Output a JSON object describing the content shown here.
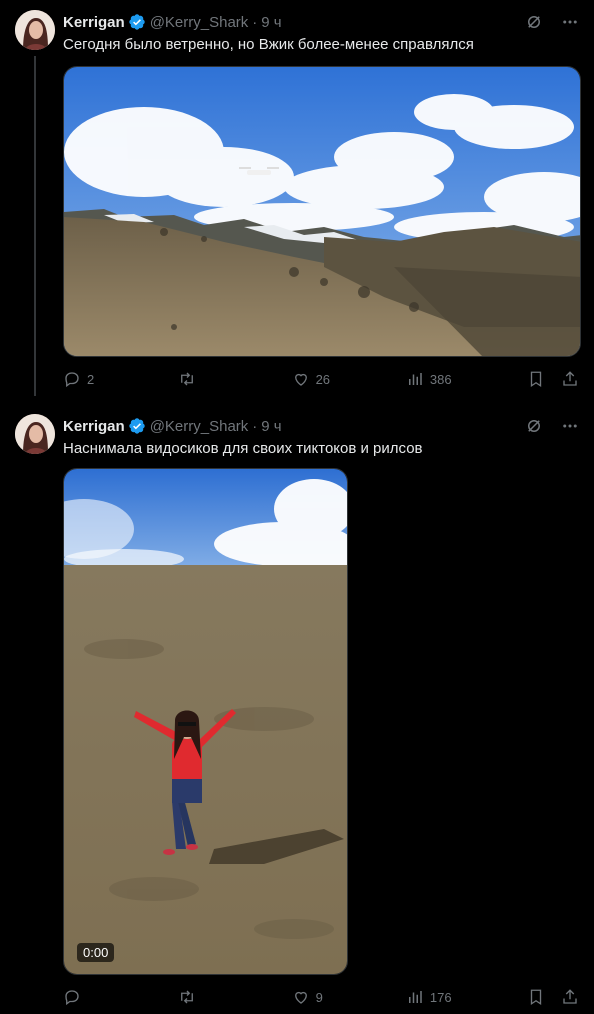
{
  "tweets": [
    {
      "author_name": "Kerrigan",
      "handle": "@Kerry_Shark",
      "separator": "·",
      "time": "9 ч",
      "text": "Сегодня было ветренно, но Вжик более-менее справлялся",
      "replies": "2",
      "retweets": "",
      "likes": "26",
      "views": "386"
    },
    {
      "author_name": "Kerrigan",
      "handle": "@Kerry_Shark",
      "separator": "·",
      "time": "9 ч",
      "text": "Наснимала видосиков для своих тиктоков и рилсов",
      "video_time": "0:00",
      "replies": "",
      "retweets": "",
      "likes": "9",
      "views": "176"
    }
  ],
  "colors": {
    "background": "#000000",
    "text": "#e7e9ea",
    "secondary": "#71767b",
    "verified": "#1d9bf0"
  }
}
